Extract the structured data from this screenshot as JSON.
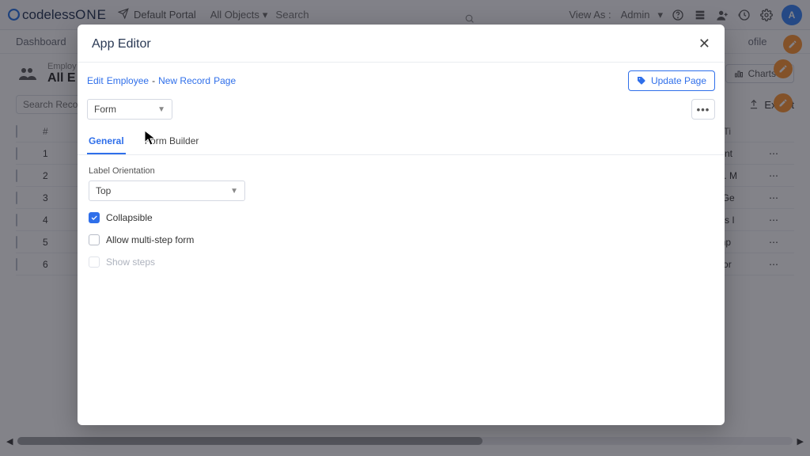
{
  "topbar": {
    "brand_prefix": "codeless",
    "brand_suffix": "ONE",
    "portal_label": "Default Portal",
    "all_objects_label": "All Objects",
    "search_placeholder": "Search",
    "viewas_label": "View As :",
    "viewas_value": "Admin",
    "avatar_initial": "A"
  },
  "bgtabs": {
    "dashboard": "Dashboard"
  },
  "page": {
    "small": "Employ",
    "big": "All E",
    "charts_label": "Charts",
    "profile_label": "ofile",
    "export_label": "Export",
    "search_placeholder": "Search Record"
  },
  "table": {
    "col_hash": "#",
    "col_job": "Job Ti",
    "rows": [
      {
        "num": "1",
        "job": "HR Int"
      },
      {
        "num": "2",
        "job": "Asst. M"
      },
      {
        "num": "3",
        "job": "HR Ge"
      },
      {
        "num": "4",
        "job": "Sales I"
      },
      {
        "num": "5",
        "job": "Camp"
      },
      {
        "num": "6",
        "job": "Junior"
      }
    ]
  },
  "modal": {
    "title": "App Editor",
    "crumb_edit": "Edit",
    "crumb_object": "Employee",
    "crumb_sep": "-",
    "crumb_page": "New Record",
    "crumb_final": "Page",
    "update_label": "Update Page",
    "form_select": "Form",
    "tabs": {
      "general": "General",
      "builder": "Form Builder"
    },
    "label_orientation_label": "Label Orientation",
    "label_orientation_value": "Top",
    "chk_collapsible": "Collapsible",
    "chk_multistep": "Allow multi-step form",
    "chk_showsteps": "Show steps"
  }
}
